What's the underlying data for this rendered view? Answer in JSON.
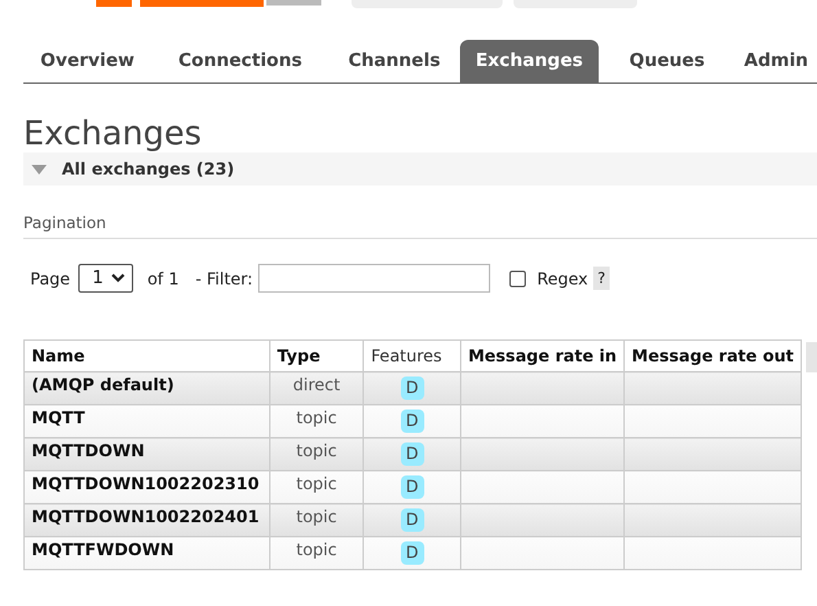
{
  "tabs": [
    {
      "label": "Overview",
      "selected": false
    },
    {
      "label": "Connections",
      "selected": false
    },
    {
      "label": "Channels",
      "selected": false
    },
    {
      "label": "Exchanges",
      "selected": true
    },
    {
      "label": "Queues",
      "selected": false
    },
    {
      "label": "Admin",
      "selected": false
    }
  ],
  "page_title": "Exchanges",
  "section": {
    "title": "All exchanges (23)",
    "expanded": true
  },
  "pagination": {
    "heading": "Pagination",
    "page_label": "Page",
    "page_value": "1",
    "of_label": "of 1",
    "filter_label": "- Filter:",
    "regex_label": "Regex",
    "regex_checked": false,
    "help": "?"
  },
  "table": {
    "columns": [
      "Name",
      "Type",
      "Features",
      "Message rate in",
      "Message rate out"
    ],
    "rows": [
      {
        "name": "(AMQP default)",
        "type": "direct",
        "features": [
          "D"
        ]
      },
      {
        "name": "MQTT",
        "type": "topic",
        "features": [
          "D"
        ]
      },
      {
        "name": "MQTTDOWN",
        "type": "topic",
        "features": [
          "D"
        ]
      },
      {
        "name": "MQTTDOWN1002202310",
        "type": "topic",
        "features": [
          "D"
        ]
      },
      {
        "name": "MQTTDOWN1002202401",
        "type": "topic",
        "features": [
          "D"
        ]
      },
      {
        "name": "MQTTFWDOWN",
        "type": "topic",
        "features": [
          "D"
        ]
      }
    ]
  }
}
